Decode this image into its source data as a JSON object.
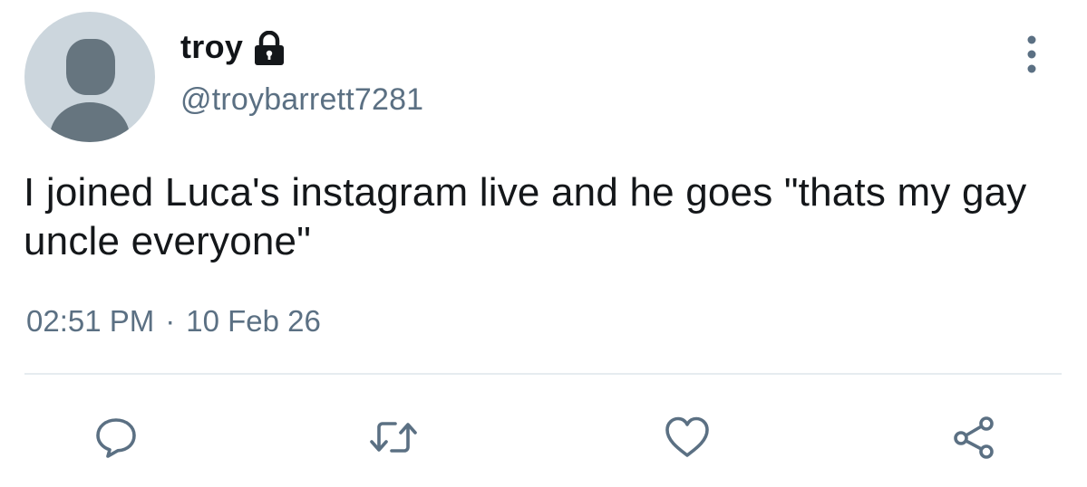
{
  "user": {
    "display_name": "troy",
    "handle": "@troybarrett7281",
    "protected": true
  },
  "tweet": {
    "text": "I joined Luca's instagram live and he goes \"thats my gay uncle everyone\"",
    "time": "02:51 PM",
    "separator": "·",
    "date": "10 Feb 26"
  },
  "actions": {
    "icons": [
      "reply-icon",
      "retweet-icon",
      "like-icon",
      "share-icon"
    ]
  },
  "colors": {
    "text_primary": "#14171a",
    "text_secondary": "#5b7083",
    "icon": "#5b7083",
    "avatar_bg": "#ccd6dd",
    "avatar_fg": "#66757f",
    "divider": "#e6ecf0"
  }
}
